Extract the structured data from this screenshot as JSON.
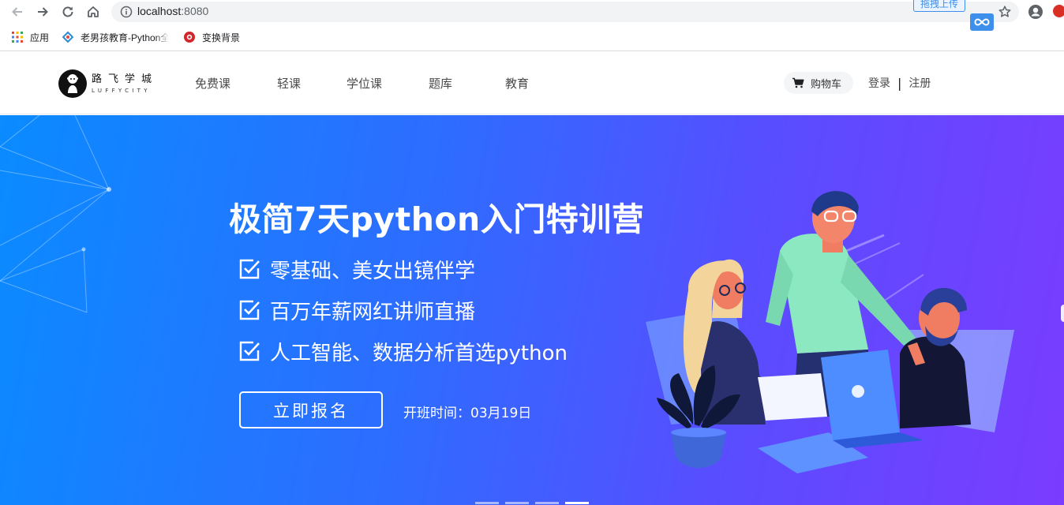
{
  "browser": {
    "url_host": "localhost",
    "url_port": ":8080",
    "extension_label": "拖拽上传",
    "bookmarks": [
      {
        "label": "应用",
        "icon": "apps-grid-icon"
      },
      {
        "label": "老男孩教育-Python全",
        "icon": "site-favicon-icon"
      },
      {
        "label": "变换背景",
        "icon": "red-circle-favicon-icon"
      }
    ]
  },
  "header": {
    "logo_cn": "路飞学城",
    "logo_en": "LUFFYCITY",
    "nav": [
      "免费课",
      "轻课",
      "学位课",
      "题库",
      "教育"
    ],
    "cart_label": "购物车",
    "login_label": "登录",
    "separator": "|",
    "register_label": "注册"
  },
  "banner": {
    "title": "极简7天python入门特训营",
    "features": [
      "零基础、美女出镜伴学",
      "百万年薪网红讲师直播",
      "人工智能、数据分析首选python"
    ],
    "cta_label": "立即报名",
    "start_time": "开班时间：03月19日",
    "slides_total": 4,
    "active_slide": 4
  },
  "colors": {
    "banner_start": "#0a8bff",
    "banner_end": "#7a3cff",
    "text_white": "#ffffff"
  }
}
